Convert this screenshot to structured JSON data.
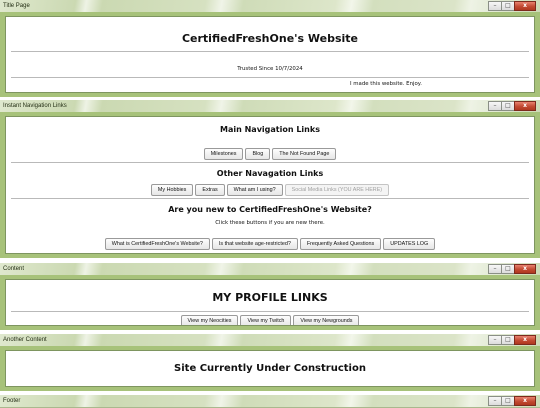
{
  "windows": {
    "title_page": {
      "title": "Title Page",
      "heading": "CertifiedFreshOne's Website",
      "trusted": "Trusted Since 10/7/2024",
      "made": "I made this website. Enjoy."
    },
    "nav": {
      "title": "Instant Navigation Links",
      "main_heading": "Main Navigation Links",
      "main_links": [
        "Milestones",
        "Blog",
        "The Not Found Page"
      ],
      "other_heading": "Other Navagation Links",
      "other_links": [
        "My Hobbies",
        "Extras",
        "What am I using?",
        "Social Media Links (YOU ARE HERE)"
      ],
      "new_heading": "Are you new to CertifiedFreshOne's Website?",
      "new_sub": "Click these buttons if you are new there.",
      "new_links": [
        "What is CertifiedFreshOne's Website?",
        "Is that website age-restricted?",
        "Frequently Asked Questions",
        "UPDATES LOG"
      ]
    },
    "content": {
      "title": "Content",
      "heading": "MY PROFILE LINKS",
      "links": [
        "View my Neocities",
        "View my Twitch",
        "View my Newgrounds"
      ]
    },
    "another": {
      "title": "Another Content",
      "heading": "Site Currently Under Construction"
    },
    "footer": {
      "title": "Footer"
    }
  },
  "window_controls": {
    "minimize": "–",
    "maximize": "□",
    "close": "x"
  },
  "colors": {
    "frame_green": "#a7c27a",
    "titlebar_green": "#cbd9b2",
    "close_red": "#c24a32"
  }
}
